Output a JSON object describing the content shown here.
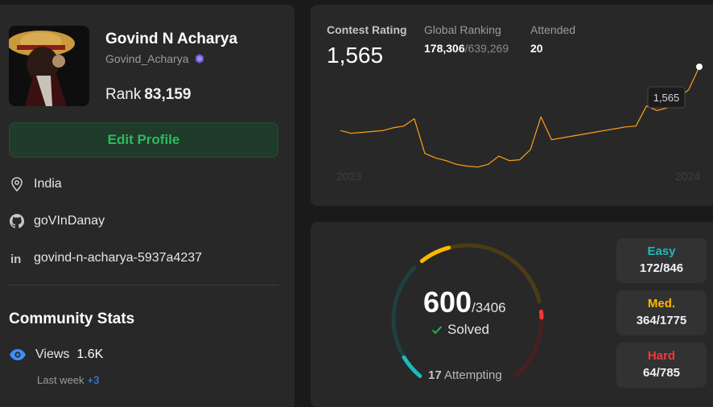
{
  "profile": {
    "display_name": "Govind N Acharya",
    "username": "Govind_Acharya",
    "rank_label": "Rank",
    "rank_value": "83,159",
    "edit_button": "Edit Profile",
    "location": "India",
    "github": "goVInDanay",
    "linkedin": "govind-n-acharya-5937a4237"
  },
  "community": {
    "title": "Community Stats",
    "views_label": "Views",
    "views_value": "1.6K",
    "last_week_label": "Last week",
    "last_week_delta": "+3"
  },
  "contest": {
    "rating_label": "Contest Rating",
    "rating_value": "1,565",
    "global_label": "Global Ranking",
    "global_rank": "178,306",
    "global_total": "/639,269",
    "attended_label": "Attended",
    "attended_value": "20",
    "tooltip": "1,565",
    "start_year": "2023",
    "end_year": "2024",
    "line_color": "#ffa116"
  },
  "chart_data": {
    "type": "line",
    "series": [
      {
        "values": [
          1495,
          1492,
          1493,
          1494,
          1495,
          1498,
          1500,
          1508,
          1470,
          1465,
          1462,
          1458,
          1456,
          1455,
          1458,
          1467,
          1462,
          1463,
          1474,
          1510,
          1485,
          1487,
          1489,
          1491,
          1493,
          1495,
          1497,
          1499,
          1500,
          1522,
          1517,
          1520,
          1530,
          1540,
          1565
        ]
      }
    ],
    "x": [
      "2023",
      "",
      "",
      "",
      "",
      "",
      "",
      "",
      "",
      "",
      "",
      "",
      "",
      "",
      "",
      "",
      "",
      "",
      "",
      "",
      "",
      "",
      "",
      "",
      "",
      "",
      "",
      "",
      "",
      "",
      "",
      "",
      "",
      "",
      "2024"
    ],
    "ylim": [
      1430,
      1580
    ],
    "grid": false,
    "title": "",
    "xlabel": "",
    "ylabel": ""
  },
  "solved": {
    "count": "600",
    "total": "/3406",
    "label": "Solved",
    "attempting_count": "17",
    "attempting_label": "Attempting",
    "easy_fraction": 0.203,
    "medium_fraction": 0.205,
    "hard_fraction": 0.082
  },
  "difficulty": {
    "easy": {
      "label": "Easy",
      "count": "172/846",
      "color": "#1cbaba"
    },
    "medium": {
      "label": "Med.",
      "count": "364/1775",
      "color": "#ffb700"
    },
    "hard": {
      "label": "Hard",
      "count": "64/785",
      "color": "#f63737"
    }
  }
}
